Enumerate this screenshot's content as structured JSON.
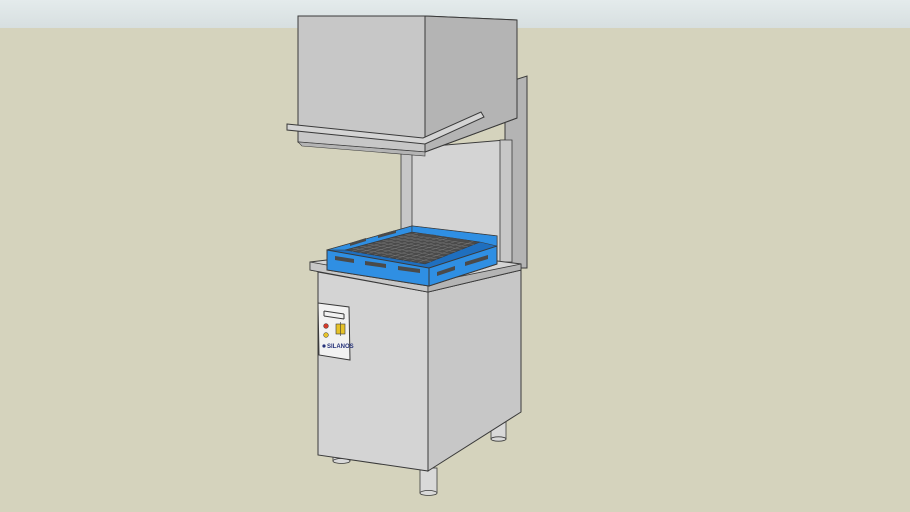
{
  "scene": {
    "colors": {
      "sky_top": "#e4ebec",
      "sky_bottom": "#d7dfe0",
      "ground": "#d5d3bd",
      "steel_light": "#d4d4d4",
      "steel_mid": "#c7c7c7",
      "steel_dark": "#b4b4b4",
      "outline": "#3a3a3a",
      "rack_blue": "#2f8fe3",
      "rack_blue_dark": "#1f6fbf",
      "rack_grid": "#4a4a4a",
      "panel_white": "#f2f2f2",
      "brand_blue": "#27337a",
      "button_red": "#d23a2a",
      "button_yellow": "#e6c229",
      "leg": "#d9d9d9"
    }
  },
  "control_panel": {
    "brand_label": "SILANOS",
    "status_light_color": "#d23a2a",
    "power_light_color": "#e6c229"
  },
  "rack": {
    "grid_rows": 9,
    "grid_cols": 11
  }
}
